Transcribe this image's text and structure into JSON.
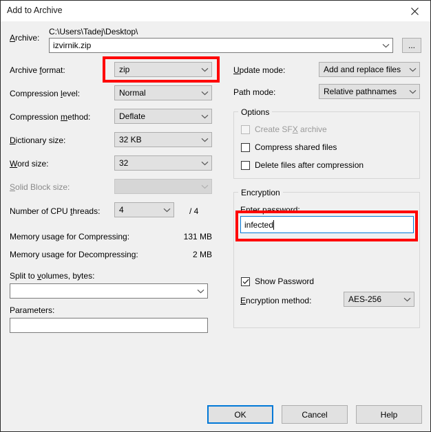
{
  "window": {
    "title": "Add to Archive",
    "close_icon": "close-icon"
  },
  "archive": {
    "label": "Archive:",
    "label_accel": "A",
    "path_text": "C:\\Users\\Tadej\\Desktop\\",
    "filename": "izvirnik.zip",
    "browse_label": "...",
    "dropdown_icon": "chevron-down-icon"
  },
  "left": {
    "fields": [
      {
        "label": "Archive format:",
        "accel": "f",
        "value": "zip",
        "disabled": false,
        "name": "archive-format"
      },
      {
        "label": "Compression level:",
        "accel": "l",
        "value": "Normal",
        "disabled": false,
        "name": "compression-level"
      },
      {
        "label": "Compression method:",
        "accel": "m",
        "value": "Deflate",
        "disabled": false,
        "name": "compression-method"
      },
      {
        "label": "Dictionary size:",
        "accel": "D",
        "value": "32 KB",
        "disabled": false,
        "name": "dictionary-size"
      },
      {
        "label": "Word size:",
        "accel": "W",
        "value": "32",
        "disabled": false,
        "name": "word-size"
      },
      {
        "label": "Solid Block size:",
        "accel": "S",
        "value": "",
        "disabled": true,
        "name": "solid-block-size"
      },
      {
        "label": "Number of CPU threads:",
        "accel": "t",
        "value": "4",
        "disabled": false,
        "name": "cpu-threads"
      }
    ],
    "cpu_threads_total": "/ 4",
    "memory_compress_label": "Memory usage for Compressing:",
    "memory_compress_value": "131 MB",
    "memory_decompress_label": "Memory usage for Decompressing:",
    "memory_decompress_value": "2 MB",
    "split_label": "Split to volumes, bytes:",
    "split_accel": "v",
    "split_value": "",
    "parameters_label": "Parameters:",
    "parameters_value": ""
  },
  "right": {
    "update_mode_label": "Update mode:",
    "update_mode_accel": "U",
    "update_mode_value": "Add and replace files",
    "path_mode_label": "Path mode:",
    "path_mode_value": "Relative pathnames",
    "options": {
      "title": "Options",
      "items": [
        {
          "label": "Create SFX archive",
          "accel": "X",
          "checked": false,
          "disabled": true,
          "name": "create-sfx-archive"
        },
        {
          "label": "Compress shared files",
          "accel": "",
          "checked": false,
          "disabled": false,
          "name": "compress-shared-files"
        },
        {
          "label": "Delete files after compression",
          "accel": "",
          "checked": false,
          "disabled": false,
          "name": "delete-files-after-compression"
        }
      ]
    },
    "encryption": {
      "title": "Encryption",
      "password_label": "Enter password:",
      "password_value": "infected",
      "show_password_label": "Show Password",
      "show_password_checked": true,
      "method_label": "Encryption method:",
      "method_accel": "E",
      "method_value": "AES-256"
    }
  },
  "buttons": {
    "ok": "OK",
    "cancel": "Cancel",
    "help": "Help"
  },
  "annotations": {
    "accent_color": "#ff0000",
    "highlight_archive_format": "archive-format-highlight",
    "highlight_password": "password-highlight"
  }
}
